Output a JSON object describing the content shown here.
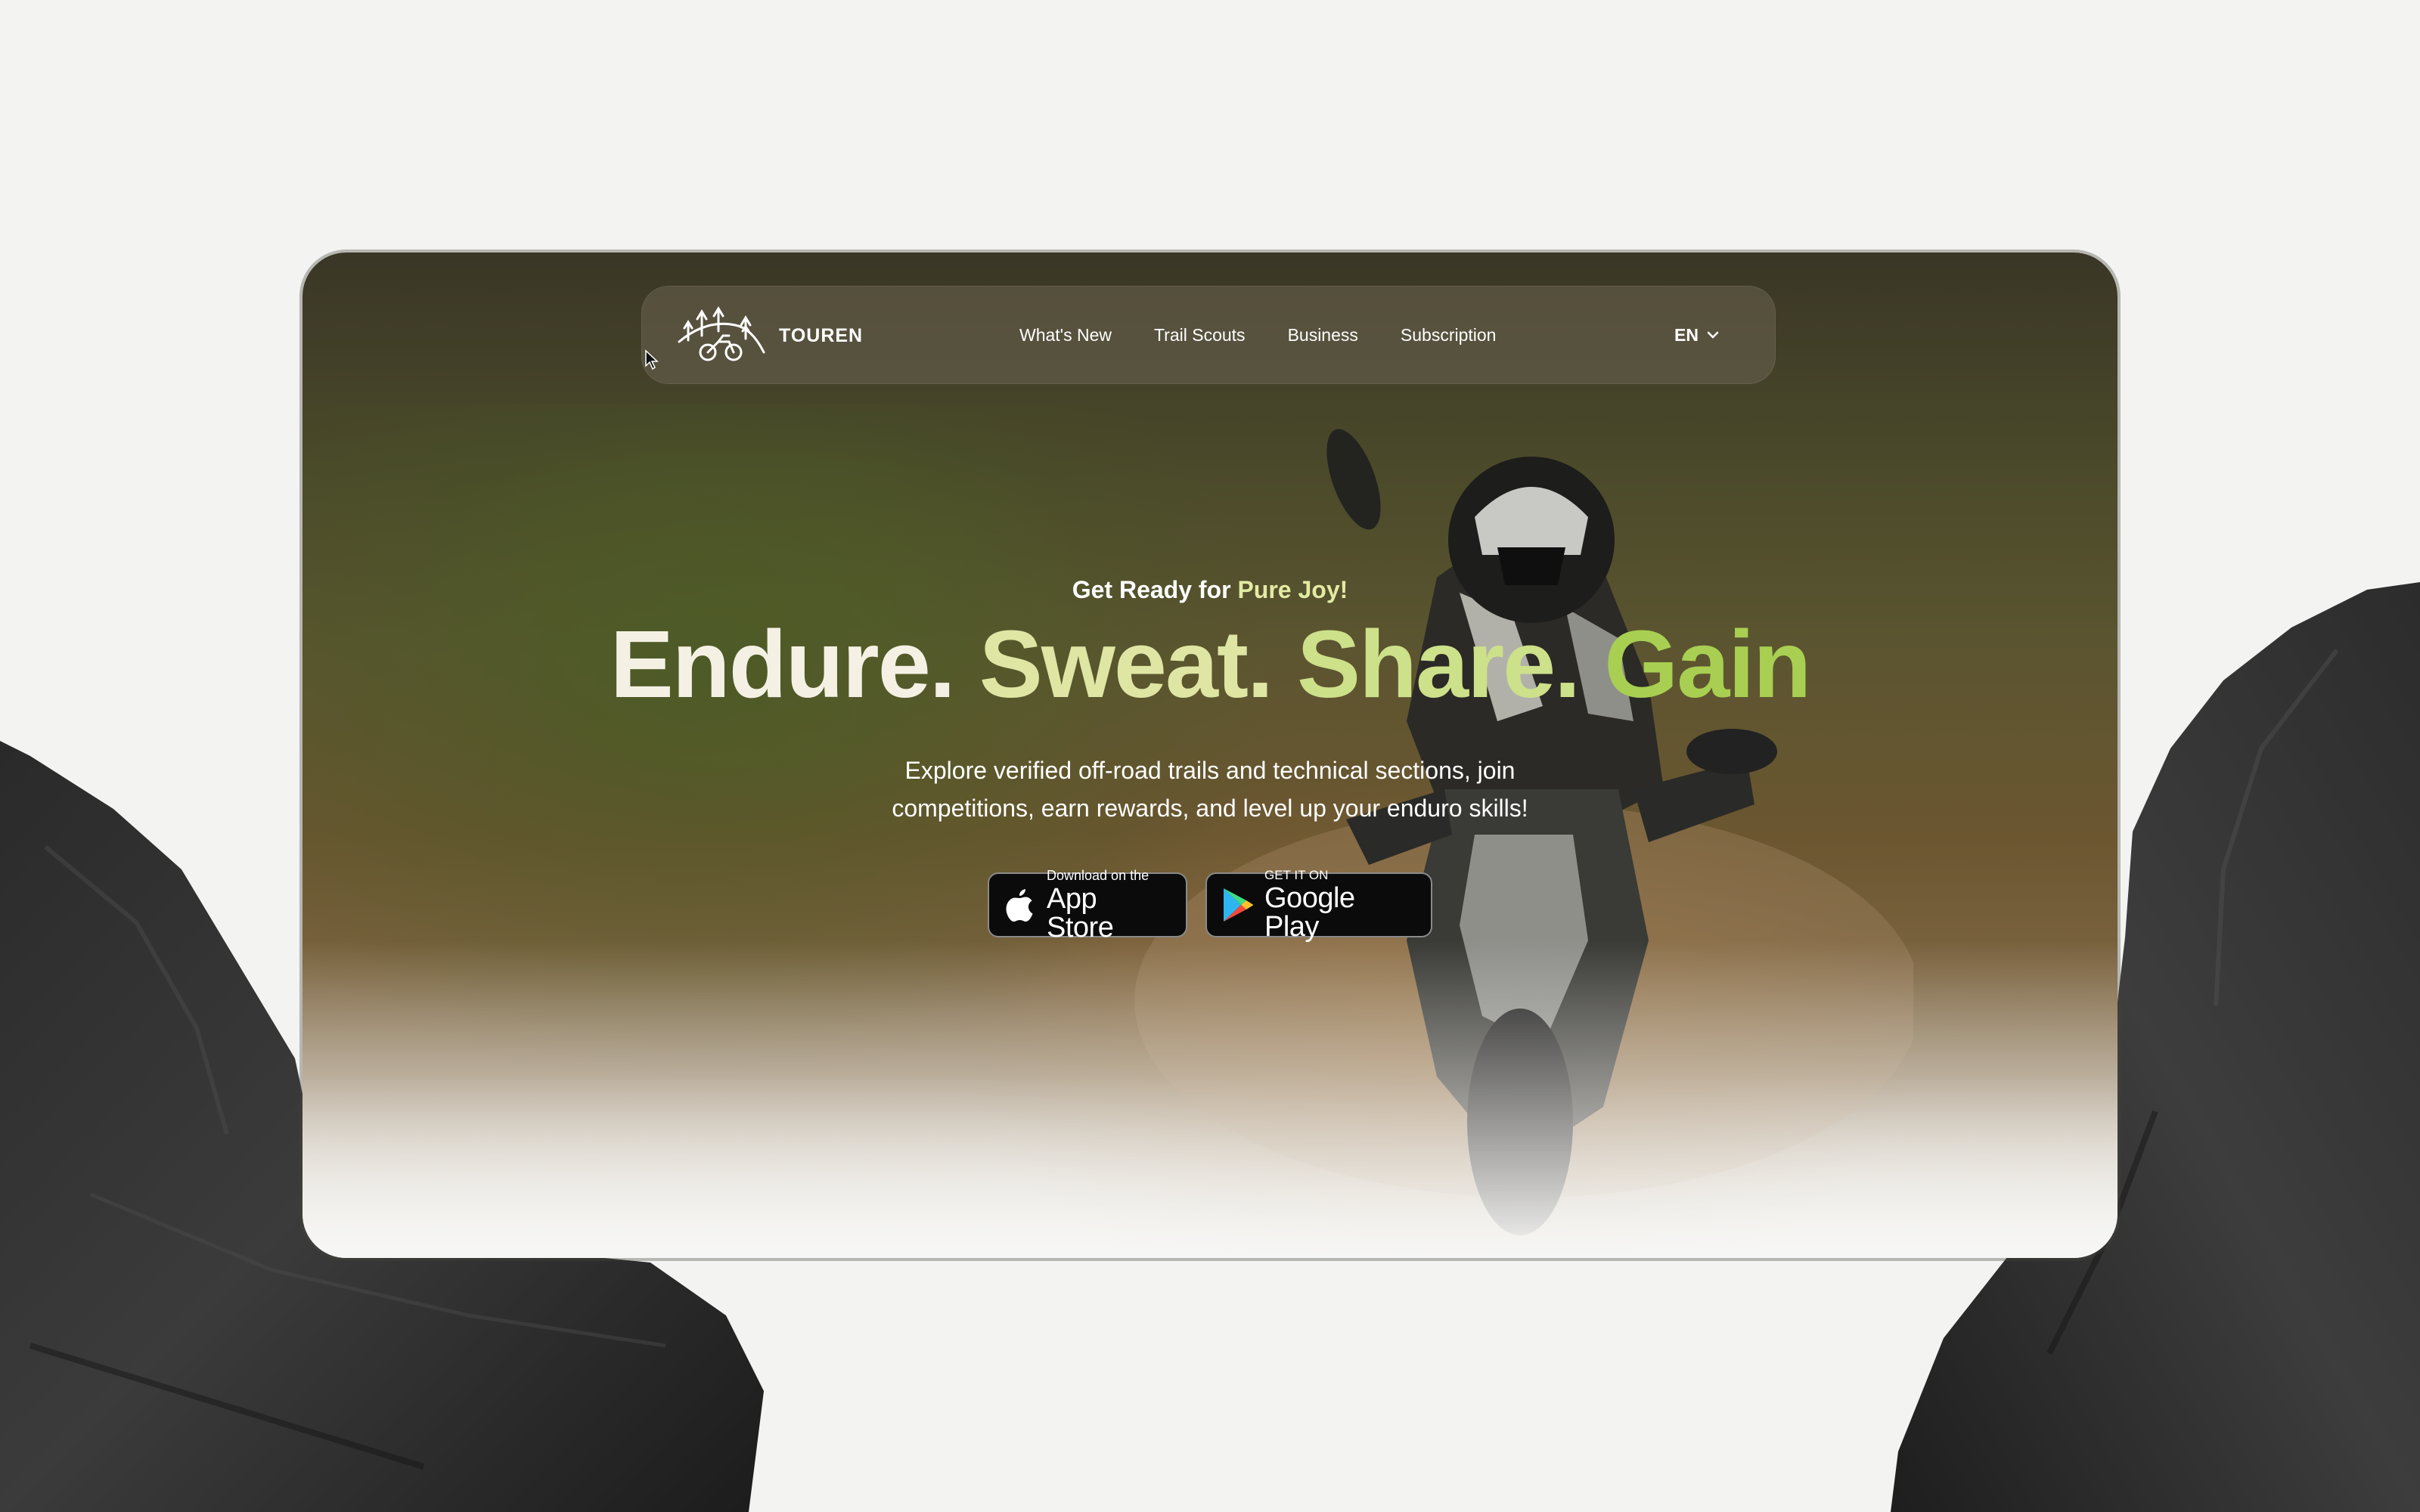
{
  "brand": {
    "name": "TOUREN",
    "logo_icon": "motorbike-trees-logo"
  },
  "nav": {
    "links": [
      "What's New",
      "Trail Scouts",
      "Business",
      "Subscription"
    ],
    "language": "EN",
    "language_icon": "chevron-down-icon"
  },
  "hero": {
    "eyebrow_prefix": "Get Ready for ",
    "eyebrow_accent": "Pure Joy!",
    "headline_words": [
      "Endure.",
      "Sweat.",
      "Share.",
      "Gain"
    ],
    "subtitle": "Explore verified off-road trails and technical sections, join competitions, earn rewards, and level up your enduro skills!"
  },
  "stores": {
    "appstore": {
      "small": "Download on the",
      "big": "App Store",
      "icon": "apple-icon"
    },
    "googleplay": {
      "small": "GET IT ON",
      "big": "Google Play",
      "icon": "google-play-icon"
    }
  },
  "colors": {
    "page_background": "#f3f3f2",
    "accent_light": "#e3eba3",
    "accent_green": "#a8cf52",
    "button_background": "#0b0b0b"
  }
}
